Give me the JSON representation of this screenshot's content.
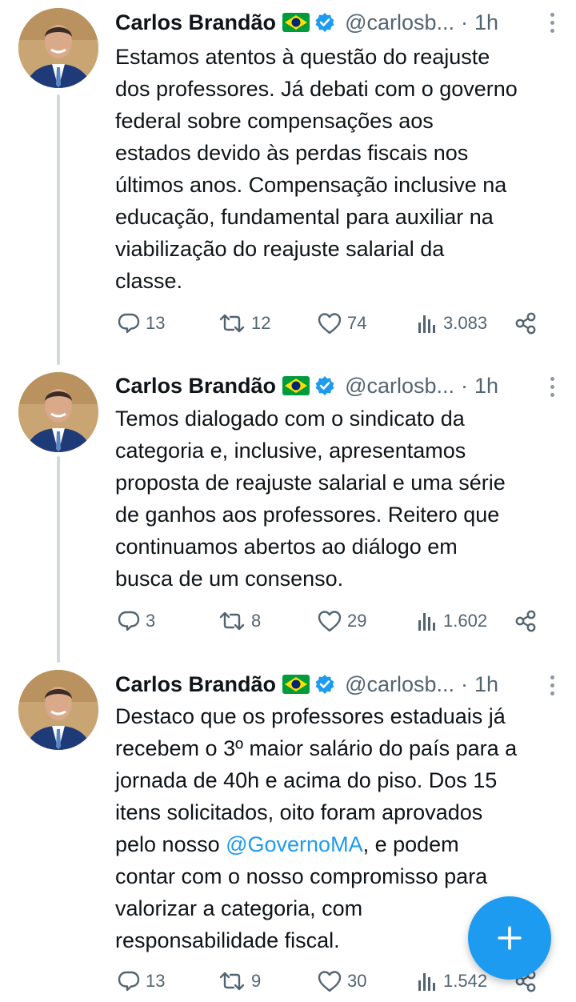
{
  "tweets": [
    {
      "name": "Carlos Brandão",
      "handle": "@carlosb...",
      "separator": "·",
      "time": "1h",
      "text_lines": [
        "Estamos atentos à questão do reajuste",
        "dos professores. Já debati com o governo",
        "federal sobre compensações aos",
        "estados devido às perdas fiscais nos",
        "últimos anos. Compensação inclusive na",
        "educação, fundamental para auxiliar na",
        "viabilização do reajuste salarial da",
        "classe."
      ],
      "replies": "13",
      "retweets": "12",
      "likes": "74",
      "views": "3.083"
    },
    {
      "name": "Carlos Brandão",
      "handle": "@carlosb...",
      "separator": "·",
      "time": "1h",
      "text_lines": [
        "Temos dialogado com o sindicato da",
        "categoria e, inclusive, apresentamos",
        "proposta de reajuste salarial e uma série",
        "de ganhos aos professores. Reitero que",
        "continuamos abertos ao diálogo em",
        "busca de um consenso."
      ],
      "replies": "3",
      "retweets": "8",
      "likes": "29",
      "views": "1.602"
    },
    {
      "name": "Carlos Brandão",
      "handle": "@carlosb...",
      "separator": "·",
      "time": "1h",
      "text_lines": [
        "Destaco que os professores estaduais já",
        "recebem o 3º maior salário do país para a",
        "jornada de 40h e acima do piso. Dos 15",
        "itens solicitados, oito foram aprovados"
      ],
      "mention_line": {
        "before": "pelo nosso ",
        "mention": "@GovernoMA",
        "after": ", e podem"
      },
      "text_lines_after": [
        "contar com o nosso compromisso para",
        "valorizar a categoria, com",
        "responsabilidade fiscal."
      ],
      "replies": "13",
      "retweets": "9",
      "likes": "30",
      "views": "1.542"
    }
  ],
  "icons": {
    "flag": "brazil-flag-icon",
    "verified": "verified-badge-icon",
    "reply": "reply-icon",
    "retweet": "retweet-icon",
    "like": "heart-icon",
    "views": "views-icon",
    "share": "share-icon",
    "more": "more-options-icon",
    "compose": "plus-icon"
  },
  "colors": {
    "accent": "#1d9bf0",
    "muted": "#536471",
    "text": "#0f1419",
    "thread_line": "#cfd9de"
  }
}
